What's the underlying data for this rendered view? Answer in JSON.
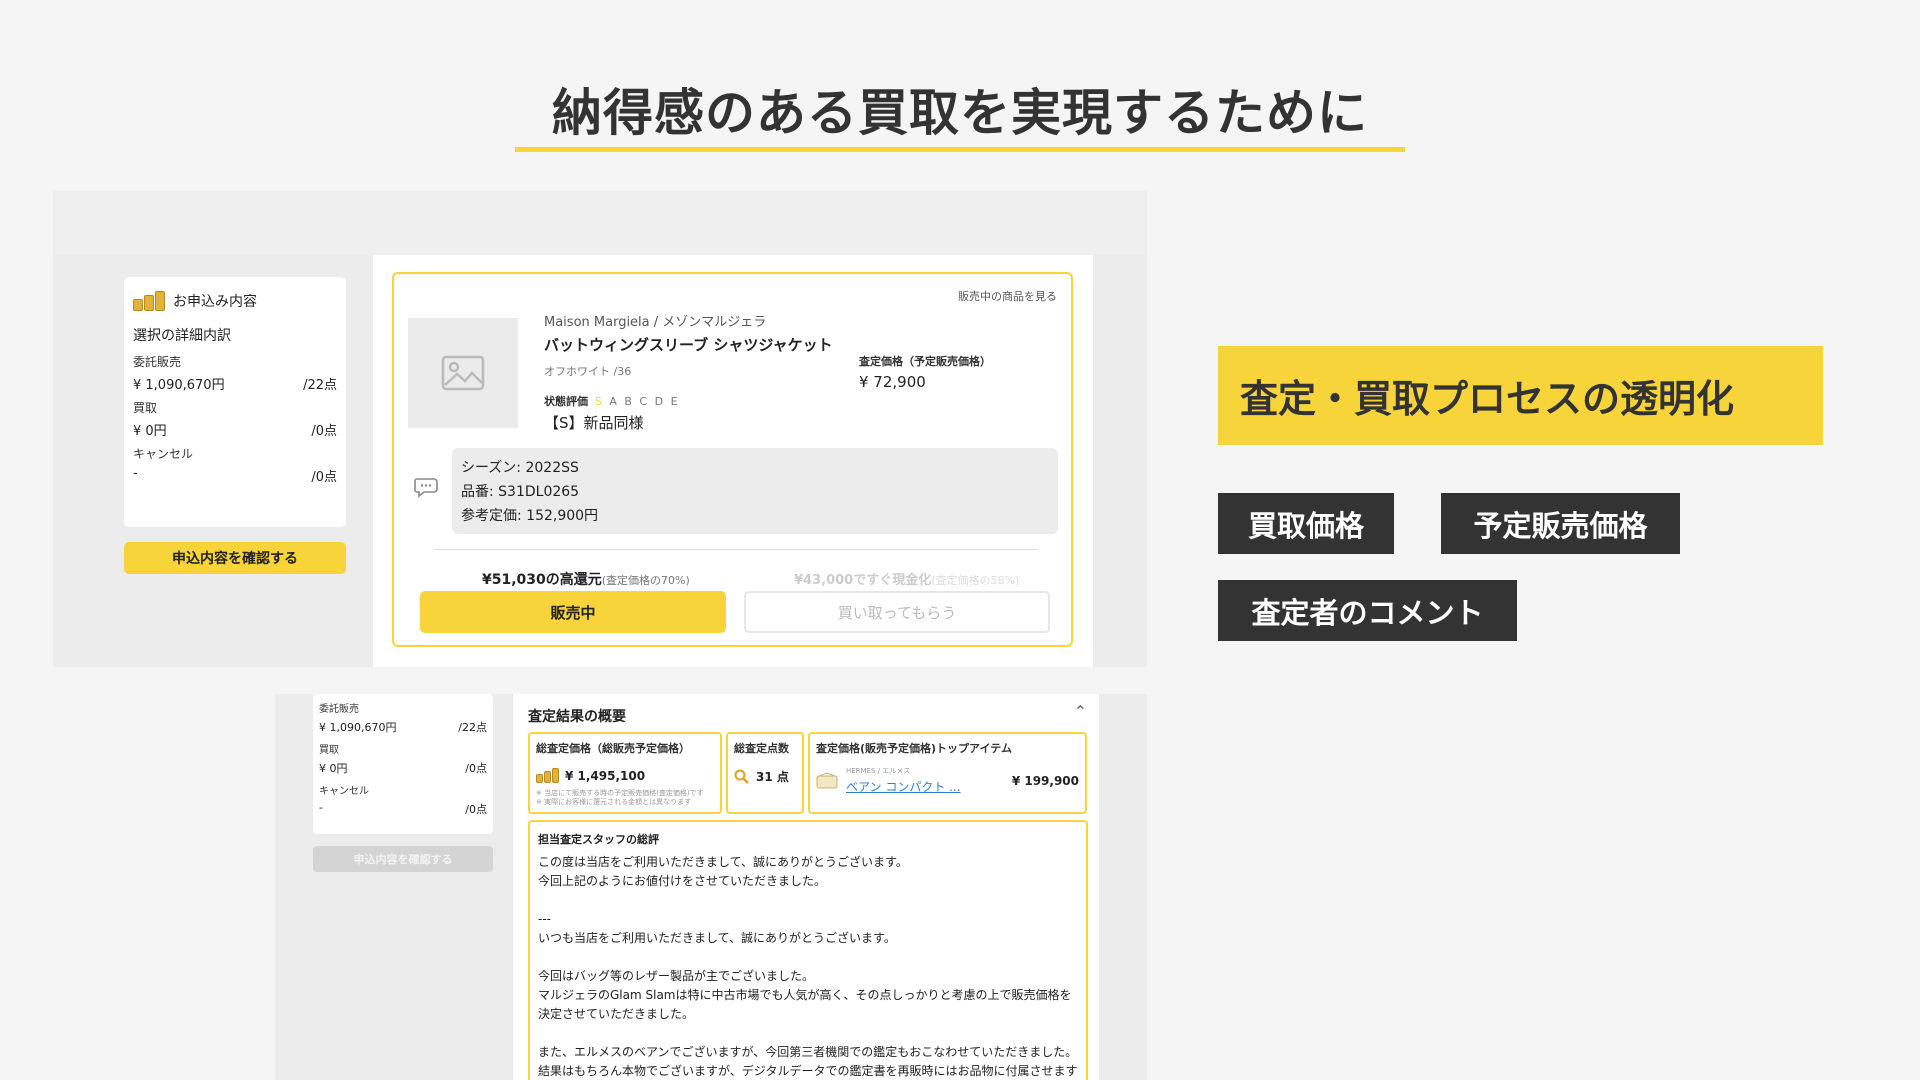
{
  "page_title": "納得感のある買取を実現するために",
  "application": {
    "summary_title": "お申込み内容",
    "summary_subtitle": "選択の詳細内訳",
    "rows": [
      {
        "label": "委託販売",
        "amount": "¥ 1,090,670円",
        "count": "/22点"
      },
      {
        "label": "買取",
        "amount": "¥ 0円",
        "count": "/0点"
      },
      {
        "label": "キャンセル",
        "amount": "-",
        "count": "/0点"
      }
    ],
    "confirm_button": "申込内容を確認する"
  },
  "item": {
    "see_selling_link": "販売中の商品を見る",
    "brand": "Maison Margiela / メゾンマルジェラ",
    "name": "バットウィングスリーブ シャツジャケット",
    "color_size": "オフホワイト /36",
    "condition_label": "状態評価",
    "condition_grades": [
      "S",
      "A",
      "B",
      "C",
      "D",
      "E"
    ],
    "condition_active": "S",
    "condition_value": "【S】新品同様",
    "estimate_label": "査定価格（予定販売価格）",
    "estimate_value": "¥ 72,900",
    "comment_lines": [
      "シーズン: 2022SS",
      "品番: S31DL0265",
      "参考定価: 152,900円"
    ],
    "option_sell_price": "¥51,030",
    "option_sell_suffix": "の高還元",
    "option_sell_note": "(査定価格の70%)",
    "option_buy_price": "¥43,000",
    "option_buy_suffix": "ですぐ現金化",
    "option_buy_note": "(査定価格の58%)",
    "sell_button": "販売中",
    "buy_button": "買い取ってもらう"
  },
  "lower": {
    "rows": [
      {
        "label": "委託販売",
        "amount": "¥ 1,090,670円",
        "count": "/22点"
      },
      {
        "label": "買取",
        "amount": "¥ 0円",
        "count": "/0点"
      },
      {
        "label": "キャンセル",
        "amount": "-",
        "count": "/0点"
      }
    ],
    "confirm_button": "申込内容を確認する",
    "overview_title": "査定結果の概要",
    "total_label": "総査定価格（総販売予定価格）",
    "total_value": "¥ 1,495,100",
    "total_note_1": "※ 当店にて販売する時の予定販売価格(査定価格)です",
    "total_note_2": "※ 実際にお客様に還元される金額とは異なります",
    "points_label": "総査定点数",
    "points_value": "31 点",
    "top_label": "査定価格(販売予定価格)トップアイテム",
    "top_brand": "HERMES / エルメス",
    "top_name": "ベアン コンパクト ...",
    "top_value": "¥ 199,900",
    "staff_title": "担当査定スタッフの総評",
    "staff_lines": [
      "この度は当店をご利用いただきまして、誠にありがとうございます。",
      "今回上記のようにお値付けをさせていただきました。",
      "",
      "---",
      "いつも当店をご利用いただきまして、誠にありがとうございます。",
      "",
      "今回はバッグ等のレザー製品が主でございました。",
      "マルジェラのGlam Slamは特に中古市場でも人気が高く、その点しっかりと考慮の上で販売価格を",
      "決定させていただきました。",
      "",
      "また、エルメスのベアンでございますが、今回第三者機関での鑑定もおこなわせていただきました。",
      "結果はもちろん本物でございますが、デジタルデータでの鑑定書を再販時にはお品物に付属させます"
    ]
  },
  "right": {
    "highlight": "査定・買取プロセスの透明化",
    "tags": [
      "買取価格",
      "予定販売価格",
      "査定者のコメント"
    ]
  },
  "colors": {
    "accent": "#f7d43a",
    "tag_bg": "#333333",
    "link": "#2a7fd4"
  }
}
